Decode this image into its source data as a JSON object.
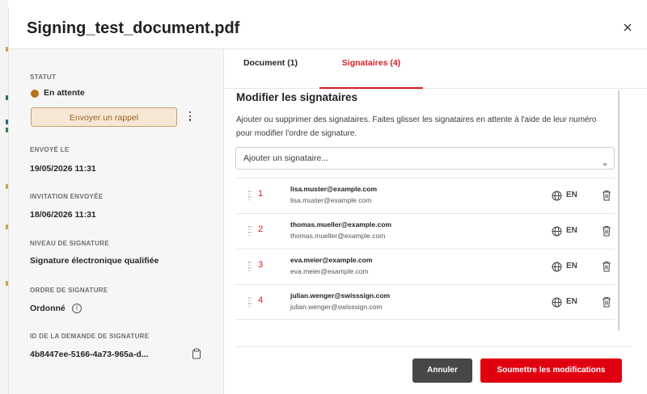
{
  "dialog": {
    "title": "Signing_test_document.pdf",
    "close_icon": "close-icon"
  },
  "sidebar": {
    "status_label": "STATUT",
    "status_value": "En attente",
    "status_color": "#b7741a",
    "reminder_button": "Envoyer un rappel",
    "more_icon": "kebab-icon",
    "sent_label": "ENVOYÉ LE",
    "sent_value": "19/05/2026 11:31",
    "invitation_label": "INVITATION ENVOYÉE",
    "invitation_value": "18/06/2026 11:31",
    "level_label": "NIVEAU DE SIGNATURE",
    "level_value": "Signature électronique qualifiée",
    "order_label": "ORDRE DE SIGNATURE",
    "order_value": "Ordonné",
    "order_info_icon": "info-icon",
    "request_id_label": "ID DE LA DEMANDE DE SIGNATURE",
    "request_id_value": "4b8447ee-5166-4a73-965a-d...",
    "copy_icon": "clipboard-icon"
  },
  "tabs": [
    {
      "label": "Document (1)",
      "active": false
    },
    {
      "label": "Signataires (4)",
      "active": true
    }
  ],
  "main": {
    "title": "Modifier les signataires",
    "description": "Ajouter ou supprimer des signataires. Faites glisser les signataires en attente à l'aide de leur numéro pour modifier l'ordre de signature.",
    "add_placeholder": "Ajouter un signataire..."
  },
  "signers": [
    {
      "order": "1",
      "name": "lisa.muster@example.com",
      "email": "lisa.muster@example.com",
      "language": "EN"
    },
    {
      "order": "2",
      "name": "thomas.mueller@example.com",
      "email": "thomas.mueller@example.com",
      "language": "EN"
    },
    {
      "order": "3",
      "name": "eva.meier@example.com",
      "email": "eva.meier@example.com",
      "language": "EN"
    },
    {
      "order": "4",
      "name": "julian.wenger@swisssign.com",
      "email": "julian.wenger@swisssign.com",
      "language": "EN"
    }
  ],
  "footer": {
    "cancel_label": "Annuler",
    "submit_label": "Soumettre les modifications"
  },
  "colors": {
    "accent": "#d21e24",
    "submit": "#e00010",
    "cancel": "#474747",
    "pending": "#b7741a"
  }
}
